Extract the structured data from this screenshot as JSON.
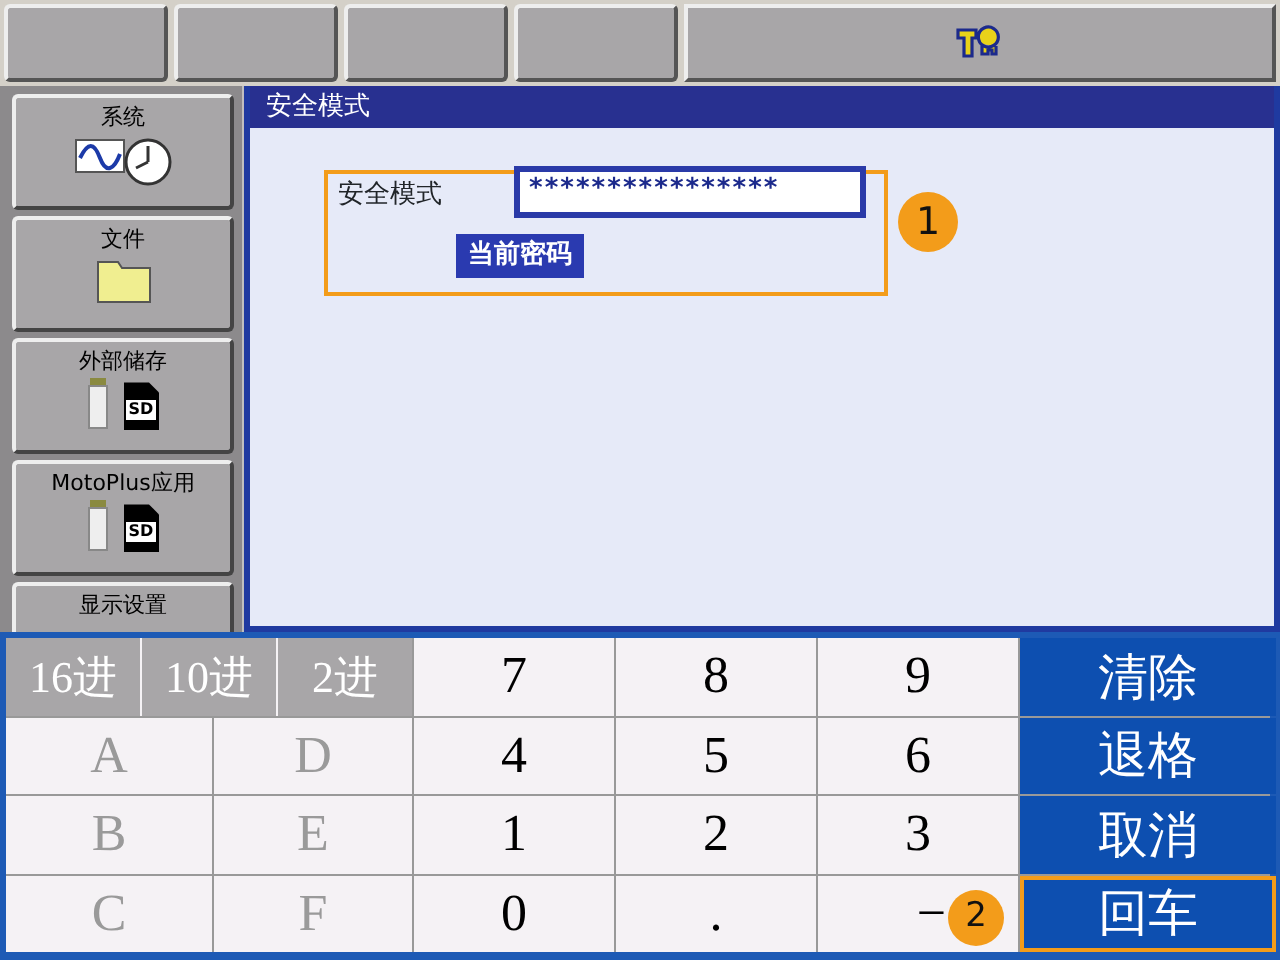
{
  "sidebar": {
    "items": [
      {
        "label": "系统",
        "kind": "system"
      },
      {
        "label": "文件",
        "kind": "folder"
      },
      {
        "label": "外部储存",
        "kind": "storage",
        "card_label": "SD"
      },
      {
        "label": "MotoPlus应用",
        "kind": "storage",
        "card_label": "SD"
      },
      {
        "label": "显示设置",
        "kind": "plain"
      }
    ]
  },
  "panel": {
    "title": "安全模式",
    "field_label": "安全模式",
    "field_value": "****************",
    "button": "当前密码",
    "callout": "1"
  },
  "keypad": {
    "mode_keys": [
      "16进",
      "10进",
      "2进"
    ],
    "hex_keys": [
      [
        {
          "label": "A",
          "disabled": true
        },
        {
          "label": "D",
          "disabled": true
        }
      ],
      [
        {
          "label": "B",
          "disabled": true
        },
        {
          "label": "E",
          "disabled": true
        }
      ],
      [
        {
          "label": "C",
          "disabled": true
        },
        {
          "label": "F",
          "disabled": true
        }
      ]
    ],
    "digit_keys": [
      [
        "7",
        "8",
        "9"
      ],
      [
        "4",
        "5",
        "6"
      ],
      [
        "1",
        "2",
        "3"
      ],
      [
        "0",
        ".",
        "−"
      ]
    ],
    "action_keys": [
      {
        "label": "清除",
        "highlighted": false
      },
      {
        "label": "退格",
        "highlighted": false
      },
      {
        "label": "取消",
        "highlighted": false
      },
      {
        "label": "回车",
        "highlighted": true
      }
    ],
    "callout": "2"
  }
}
